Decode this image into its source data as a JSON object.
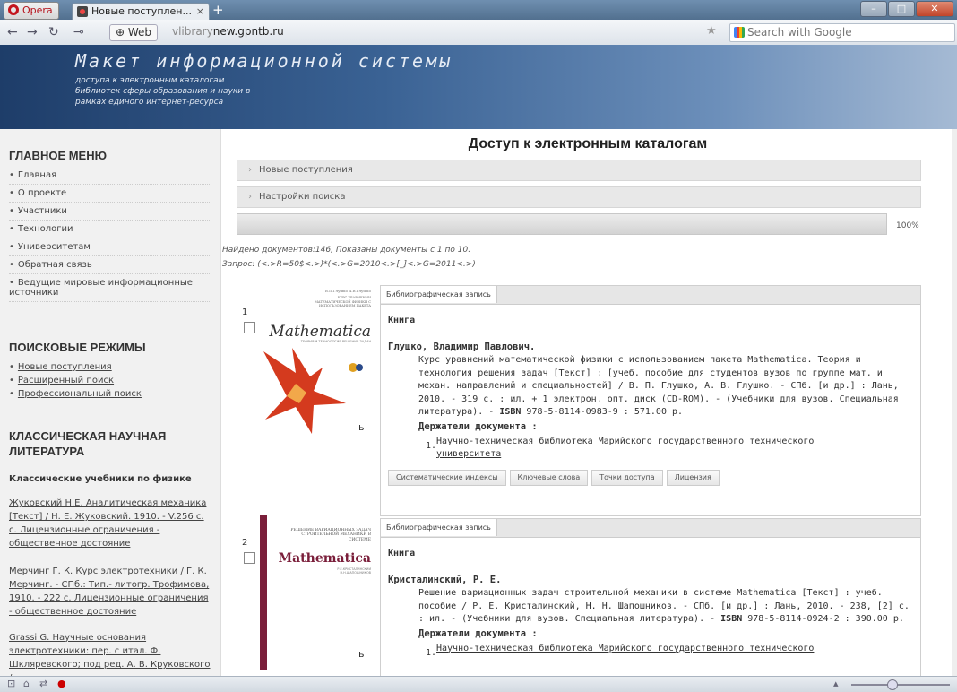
{
  "browser": {
    "opera_label": "Opera",
    "tab_title": "Новые поступлен...",
    "tab_close": "×",
    "new_tab": "+",
    "web_button": "Web",
    "url_domain": "vlibrary",
    "url_rest": "new.gpntb.ru",
    "search_placeholder": "Search with Google"
  },
  "banner": {
    "title": "Макет информационной системы",
    "subtitle": "доступа к электронным каталогам библиотек сферы образования и науки в рамках единого интернет-ресурса"
  },
  "sidebar": {
    "main_menu_title": "ГЛАВНОЕ МЕНЮ",
    "main_menu": [
      "Главная",
      "О проекте",
      "Участники",
      "Технологии",
      "Университетам",
      "Обратная связь",
      "Ведущие мировые информационные источники"
    ],
    "search_modes_title": "ПОИСКОВЫЕ РЕЖИМЫ",
    "search_modes": [
      "Новые поступления",
      "Расширенный поиск",
      "Профессиональный поиск"
    ],
    "classic_title": "КЛАССИЧЕСКАЯ НАУЧНАЯ ЛИТЕРАТУРА",
    "classic_subtitle": "Классические учебники по физике",
    "classic_links": [
      "Жуковский Н.Е. Аналитическая механика [Текст] / Н. Е. Жуковский. 1910. - V.256 с. с. Лицензионные ограничения - общественное достояние",
      "Мерчинг Г. К. Курс электротехники / Г. К. Мерчинг. - СПб.: Тип.- литогр. Трофимова, 1910. - 222 с. Лицензионные ограничения - общественное достояние",
      "Grassi G. Научные основания электротехники: пер. с итал. Ф. Шкляревского; под ред. А. В. Круковского /"
    ]
  },
  "main": {
    "title": "Доступ к электронным каталогам",
    "accordion": [
      "Новые поступления",
      "Настройки поиска"
    ],
    "progress_pct": "100%",
    "progress_value": 1.0,
    "found_text": "Найдено документов:146, Показаны документы с 1 по 10.",
    "query_text": "Запрос:  (<.>R=50$<.>)*(<.>G=2010<.>[_]<.>G=2011<.>)"
  },
  "records": [
    {
      "num": "1",
      "tab": "Библиографическая запись",
      "type": "Книга",
      "author": "Глушко, Владимир Павлович.",
      "text": "Курс уравнений математической физики с использованием пакета Mathematica. Теория и технология решения задач [Текст] : [учеб. пособие для студентов вузов по группе мат. и механ. направлений и специальностей] / В. П. Глушко, А. В. Глушко. - СПб. [и др.] : Лань, 2010. - 319 с. : ил. + 1 электрон. опт. диск (CD-ROM). - (Учебники для вузов. Специальная литература). - ",
      "isbn_label": "ISBN",
      "isbn_rest": " 978-5-8114-0983-9 : 571.00 р.",
      "holders_title": "Держатели документа :",
      "holder_num": "1.",
      "holder": "Научно-техническая библиотека Марийского государственного технического университета",
      "buttons": [
        "Систематические индексы",
        "Ключевые слова",
        "Точки доступа",
        "Лицензия"
      ],
      "cover_title": "Mathematica",
      "cover_top": "В.П.Глушко А.В.Глушко",
      "cover_sub": "КУРС УРАВНЕНИЙ МАТЕМАТИЧЕСКОЙ ФИЗИКИ С ИСПОЛЬЗОВАНИЕМ ПАКЕТА",
      "cover_note": "ТЕОРИЯ И ТЕХНОЛОГИЯ РЕШЕНИЯ ЗАДАЧ"
    },
    {
      "num": "2",
      "tab": "Библиографическая запись",
      "type": "Книга",
      "author": "Кристалинский, Р. Е.",
      "text": "Решение вариационных задач строительной механики в системе Mathematica [Текст] : учеб. пособие / Р. Е. Кристалинский, Н. Н. Шапошников. - СПб. [и др.] : Лань, 2010. - 238, [2] с. : ил. - (Учебники для вузов. Специальная литература). - ",
      "isbn_label": "ISBN",
      "isbn_rest": " 978-5-8114-0924-2 : 390.00 р.",
      "holders_title": "Держатели документа :",
      "holder_num": "1.",
      "holder": "Научно-техническая библиотека Марийского государственного технического",
      "cover_title": "Mathematica",
      "cover_sub": "РЕШЕНИЕ ВАРИАЦИОННЫХ ЗАДАЧ СТРОИТЕЛЬНОЙ МЕХАНИКИ В СИСТЕМЕ",
      "cover_note": "Р.Е.КРИСТАЛИНСКИЙ Н.Н.ШАПОШНИКОВ"
    }
  ]
}
